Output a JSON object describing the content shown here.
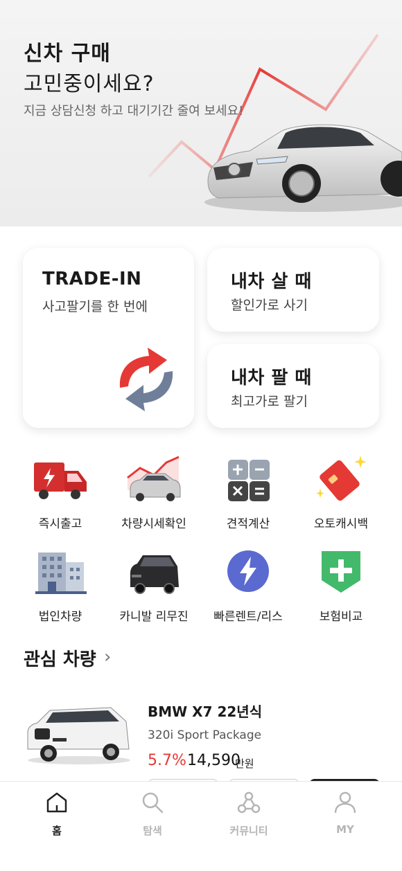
{
  "hero": {
    "title_line1": "신차 구매",
    "title_line2": "고민중이세요?",
    "subtitle": "지금 상담신청 하고 대기기간 줄여 보세요!"
  },
  "trade_cards": {
    "tradein": {
      "title": "TRADE-IN",
      "subtitle": "사고팔기를 한 번에"
    },
    "buy": {
      "title": "내차 살 때",
      "subtitle": "할인가로 사기"
    },
    "sell": {
      "title": "내차 팔 때",
      "subtitle": "최고가로 팔기"
    }
  },
  "menu": [
    {
      "label": "즉시출고",
      "icon": "truck-icon"
    },
    {
      "label": "차량시세확인",
      "icon": "car-price-chart-icon"
    },
    {
      "label": "견적계산",
      "icon": "calculator-icon"
    },
    {
      "label": "오토캐시백",
      "icon": "card-sparkle-icon"
    },
    {
      "label": "법인차량",
      "icon": "building-icon"
    },
    {
      "label": "카니발 리무진",
      "icon": "van-icon"
    },
    {
      "label": "빠른렌트/리스",
      "icon": "lightning-icon"
    },
    {
      "label": "보험비교",
      "icon": "shield-plus-icon"
    }
  ],
  "favorites": {
    "section_title": "관심 차량",
    "car": {
      "name": "BMW X7 22년식",
      "trim": "320i Sport Package",
      "rate": "5.7%",
      "price": "14,590",
      "unit": "만원"
    }
  },
  "bottom_nav": [
    {
      "label": "홈",
      "icon": "home-icon",
      "active": true
    },
    {
      "label": "탐색",
      "icon": "search-icon",
      "active": false
    },
    {
      "label": "커뮤니티",
      "icon": "community-icon",
      "active": false
    },
    {
      "label": "MY",
      "icon": "user-icon",
      "active": false
    }
  ],
  "colors": {
    "accent_red": "#e53935",
    "arrow_gray": "#6f7f9a"
  }
}
